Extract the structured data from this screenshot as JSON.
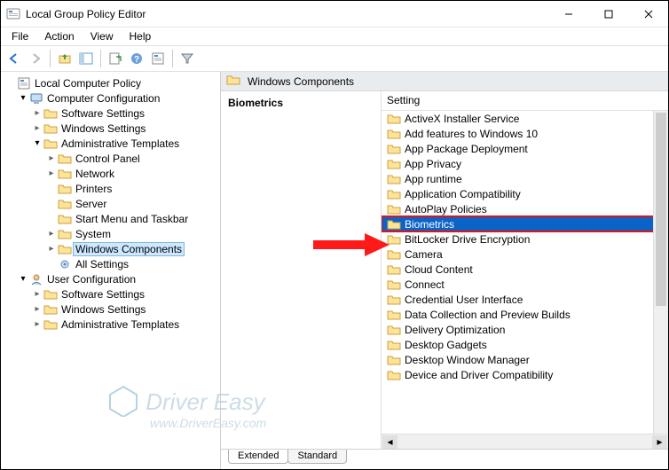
{
  "window": {
    "title": "Local Group Policy Editor"
  },
  "menu": {
    "file": "File",
    "action": "Action",
    "view": "View",
    "help": "Help"
  },
  "tree": {
    "root": "Local Computer Policy",
    "computer_cfg": "Computer Configuration",
    "software_settings": "Software Settings",
    "windows_settings": "Windows Settings",
    "admin_templates": "Administrative Templates",
    "control_panel": "Control Panel",
    "network": "Network",
    "printers": "Printers",
    "server": "Server",
    "start_menu": "Start Menu and Taskbar",
    "system": "System",
    "win_components": "Windows Components",
    "all_settings": "All Settings",
    "user_cfg": "User Configuration",
    "u_software_settings": "Software Settings",
    "u_windows_settings": "Windows Settings",
    "u_admin_templates": "Administrative Templates"
  },
  "banner": {
    "title": "Windows Components"
  },
  "left_col": {
    "heading": "Biometrics"
  },
  "right_col": {
    "header": "Setting",
    "items": [
      "ActiveX Installer Service",
      "Add features to Windows 10",
      "App Package Deployment",
      "App Privacy",
      "App runtime",
      "Application Compatibility",
      "AutoPlay Policies",
      "Biometrics",
      "BitLocker Drive Encryption",
      "Camera",
      "Cloud Content",
      "Connect",
      "Credential User Interface",
      "Data Collection and Preview Builds",
      "Delivery Optimization",
      "Desktop Gadgets",
      "Desktop Window Manager",
      "Device and Driver Compatibility"
    ],
    "selected_index": 7
  },
  "tabs": {
    "extended": "Extended",
    "standard": "Standard"
  },
  "watermark": {
    "line1": "Driver Easy",
    "line2": "www.DriverEasy.com"
  }
}
